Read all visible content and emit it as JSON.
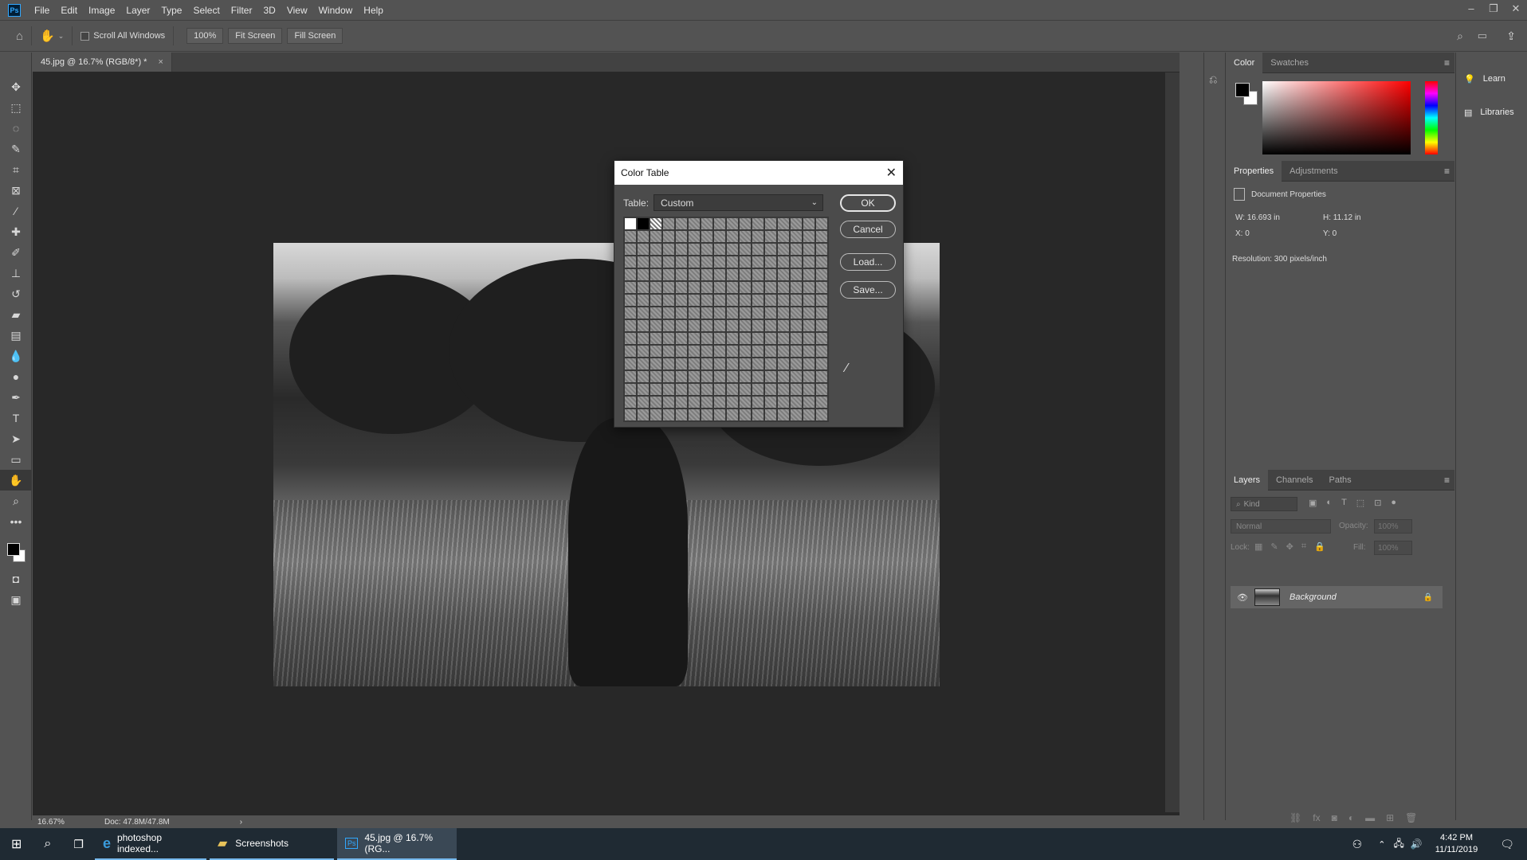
{
  "menubar": {
    "items": [
      "File",
      "Edit",
      "Image",
      "Layer",
      "Type",
      "Select",
      "Filter",
      "3D",
      "View",
      "Window",
      "Help"
    ],
    "logo": "Ps"
  },
  "options": {
    "scroll_all": "Scroll All Windows",
    "zoom": "100%",
    "fit_screen": "Fit Screen",
    "fill_screen": "Fill Screen"
  },
  "document": {
    "tab_title": "45.jpg @ 16.7% (RGB/8*) *",
    "zoom_status": "16.67%",
    "doc_status": "Doc: 47.8M/47.8M"
  },
  "dialog": {
    "title": "Color Table",
    "table_label": "Table:",
    "table_value": "Custom",
    "ok": "OK",
    "cancel": "Cancel",
    "load": "Load...",
    "save": "Save..."
  },
  "color_panel": {
    "tabs": [
      "Color",
      "Swatches"
    ],
    "fg_color": "#000000",
    "bg_color": "#ffffff"
  },
  "properties_panel": {
    "tabs": [
      "Properties",
      "Adjustments"
    ],
    "heading": "Document Properties",
    "w": "W:  16.693 in",
    "h": "H:  11.12 in",
    "x": "X:  0",
    "y": "Y:  0",
    "resolution": "Resolution: 300 pixels/inch"
  },
  "layers_panel": {
    "tabs": [
      "Layers",
      "Channels",
      "Paths"
    ],
    "kind": "Kind",
    "blend": "Normal",
    "opacity_label": "Opacity:",
    "opacity": "100%",
    "lock_label": "Lock:",
    "fill_label": "Fill:",
    "fill": "100%",
    "layer_name": "Background"
  },
  "side_panel": {
    "learn": "Learn",
    "libraries": "Libraries"
  },
  "taskbar": {
    "apps": [
      "photoshop indexed...",
      "Screenshots",
      "45.jpg @ 16.7% (RG..."
    ],
    "time": "4:42 PM",
    "date": "11/11/2019"
  }
}
